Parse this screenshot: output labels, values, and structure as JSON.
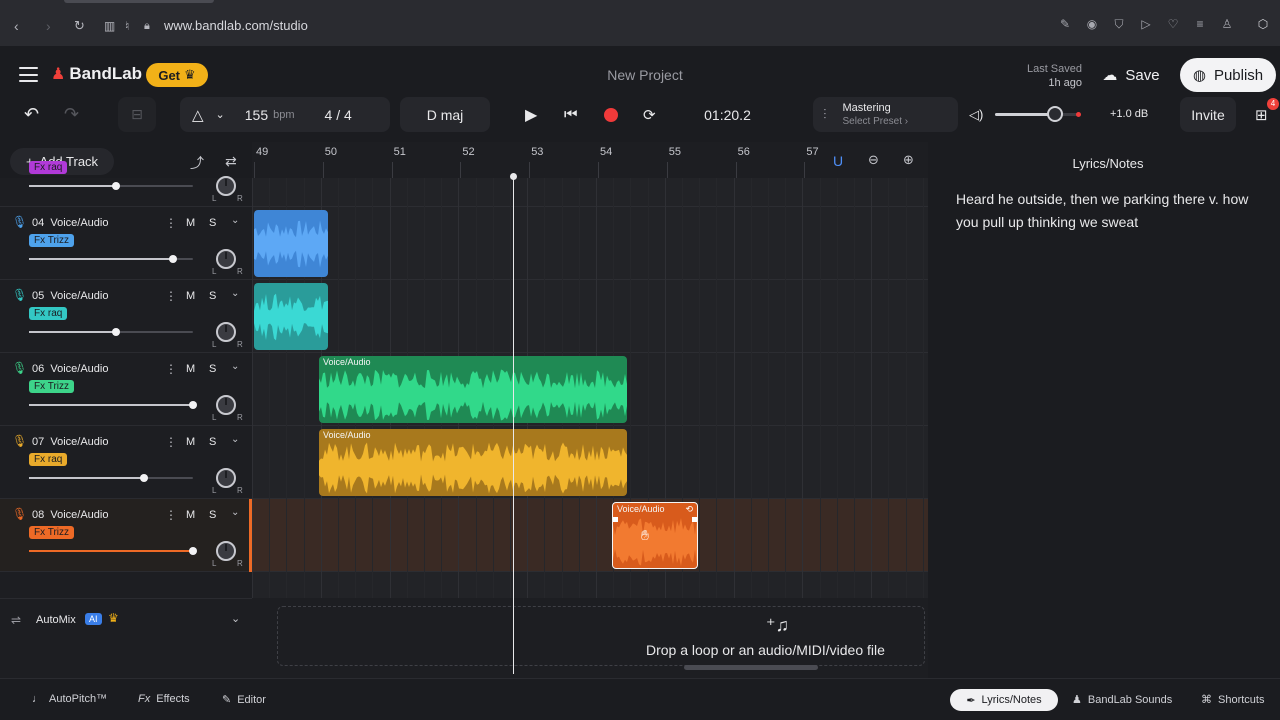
{
  "browser": {
    "url": "www.bandlab.com/studio"
  },
  "header": {
    "logo": "BandLab",
    "get_label": "Get",
    "project_title": "New Project",
    "last_saved_label": "Last Saved",
    "last_saved_time": "1h ago",
    "save_label": "Save",
    "publish_label": "Publish"
  },
  "toolbar": {
    "tempo": "155",
    "tempo_unit": "bpm",
    "time_signature": "4 / 4",
    "key": "D maj",
    "time": "01:20.2",
    "mastering_label": "Mastering",
    "mastering_preset": "Select Preset",
    "volume_db": "+1.0 dB",
    "volume_level": 0.7,
    "invite_label": "Invite",
    "gift_badge": "4"
  },
  "tracklist": {
    "add_track_label": "Add Track",
    "tracks": [
      {
        "number": "",
        "name": "",
        "fx": "Fx raq",
        "fx_color": "#b13ad8",
        "mic_color": "#b13ad8",
        "volume": 0.53
      },
      {
        "number": "04",
        "name": "Voice/Audio",
        "fx": "Fx Trizz",
        "fx_color": "#4ea2ec",
        "mic_color": "#4ea2ec",
        "volume": 0.88
      },
      {
        "number": "05",
        "name": "Voice/Audio",
        "fx": "Fx raq",
        "fx_color": "#33c8c4",
        "mic_color": "#33c8c4",
        "volume": 0.53
      },
      {
        "number": "06",
        "name": "Voice/Audio",
        "fx": "Fx Trizz",
        "fx_color": "#3dd48a",
        "mic_color": "#3dd48a",
        "volume": 1.0
      },
      {
        "number": "07",
        "name": "Voice/Audio",
        "fx": "Fx raq",
        "fx_color": "#e9aa2b",
        "mic_color": "#e9aa2b",
        "volume": 0.7
      },
      {
        "number": "08",
        "name": "Voice/Audio",
        "fx": "Fx Trizz",
        "fx_color": "#ee6a26",
        "mic_color": "#ee6a26",
        "volume": 1.0
      }
    ],
    "automix_label": "AutoMix",
    "automix_badge": "AI"
  },
  "timeline": {
    "bars": [
      "49",
      "50",
      "51",
      "52",
      "53",
      "54",
      "55",
      "56",
      "57"
    ],
    "clips": [
      {
        "label": "Voice/Audio"
      },
      {
        "label": "Voice/Audio"
      },
      {
        "label": "Voice/Audio"
      }
    ],
    "drop_text": "Drop a loop or an audio/MIDI/video file"
  },
  "notes": {
    "title": "Lyrics/Notes",
    "text": "Heard he outside, then we parking there v. how you pull up thinking we sweat"
  },
  "bottom": {
    "autopitch": "AutoPitch™",
    "effects": "Effects",
    "editor": "Editor",
    "lyrics_notes": "Lyrics/Notes",
    "sounds": "BandLab Sounds",
    "shortcuts": "Shortcuts"
  },
  "colors": {
    "accent_red": "#f0403a",
    "gold": "#f2b118",
    "background": "#1b1c20"
  }
}
